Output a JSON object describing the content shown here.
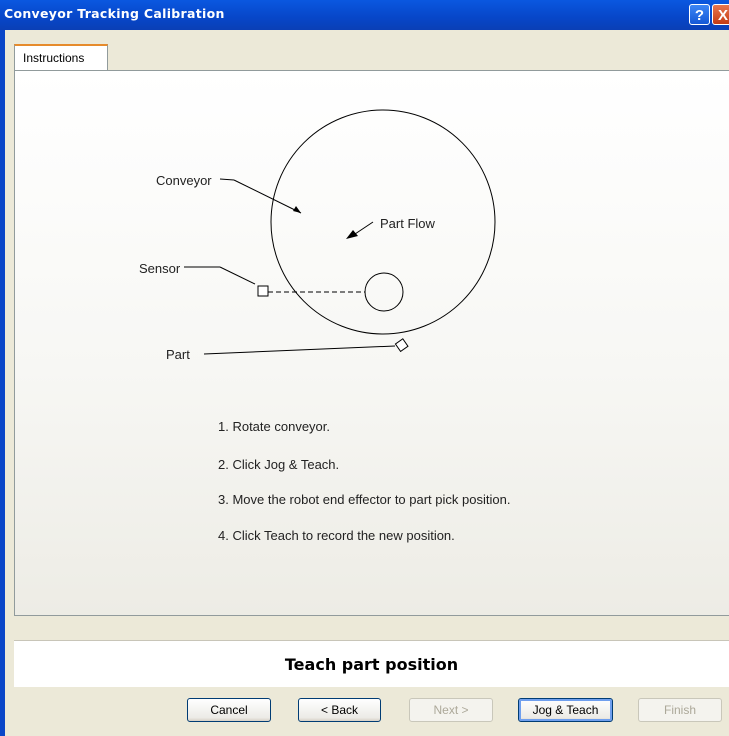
{
  "window": {
    "title": "Conveyor Tracking Calibration"
  },
  "titlebar": {
    "help_glyph": "?",
    "close_glyph": "X"
  },
  "tabs": [
    {
      "label": "Instructions"
    }
  ],
  "diagram": {
    "conveyor_label": "Conveyor",
    "partflow_label": "Part Flow",
    "sensor_label": "Sensor",
    "part_label": "Part"
  },
  "steps": [
    "1. Rotate conveyor.",
    "2. Click Jog & Teach.",
    "3. Move the robot end effector to part pick position.",
    "4. Click Teach to record the new position."
  ],
  "status": {
    "text": "Teach part position"
  },
  "buttons": {
    "cancel": "Cancel",
    "back": "< Back",
    "next": "Next >",
    "jog_teach": "Jog & Teach",
    "finish": "Finish"
  }
}
